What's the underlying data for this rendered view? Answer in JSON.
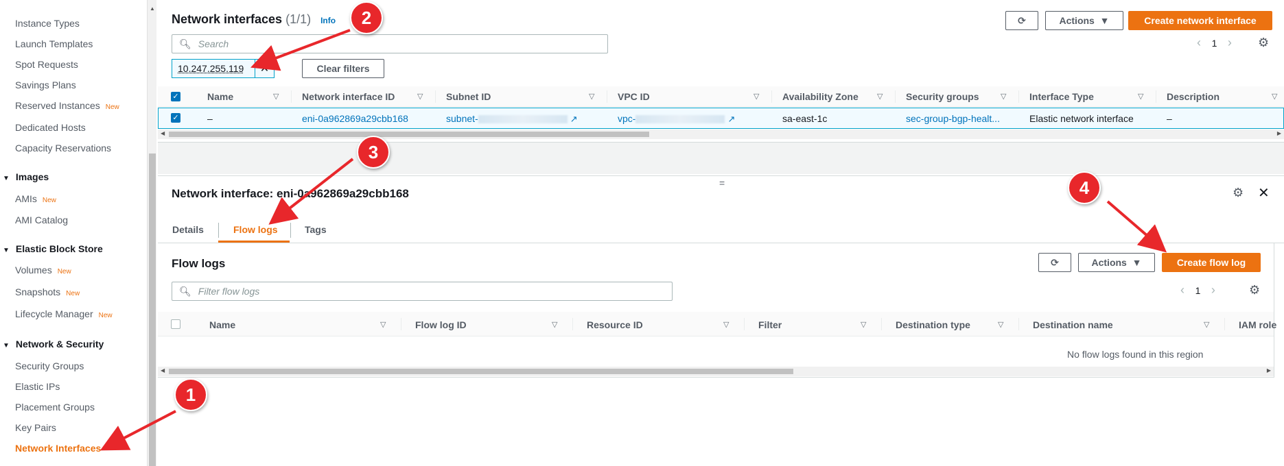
{
  "sidebar": {
    "items": [
      {
        "label": "Instance Types",
        "new": ""
      },
      {
        "label": "Launch Templates",
        "new": ""
      },
      {
        "label": "Spot Requests",
        "new": ""
      },
      {
        "label": "Savings Plans",
        "new": ""
      },
      {
        "label": "Reserved Instances",
        "new": "New"
      },
      {
        "label": "Dedicated Hosts",
        "new": ""
      },
      {
        "label": "Capacity Reservations",
        "new": ""
      }
    ],
    "images_section": "Images",
    "images_items": [
      {
        "label": "AMIs",
        "new": "New"
      },
      {
        "label": "AMI Catalog",
        "new": ""
      }
    ],
    "ebs_section": "Elastic Block Store",
    "ebs_items": [
      {
        "label": "Volumes",
        "new": "New"
      },
      {
        "label": "Snapshots",
        "new": "New"
      },
      {
        "label": "Lifecycle Manager",
        "new": "New"
      }
    ],
    "netsec_section": "Network & Security",
    "netsec_items": [
      {
        "label": "Security Groups"
      },
      {
        "label": "Elastic IPs"
      },
      {
        "label": "Placement Groups"
      },
      {
        "label": "Key Pairs"
      },
      {
        "label": "Network Interfaces"
      }
    ]
  },
  "ni_panel": {
    "title": "Network interfaces",
    "count": "(1/1)",
    "info": "Info",
    "actions_label": "Actions",
    "create_label": "Create network interface",
    "search_placeholder": "Search",
    "filter_token": "10.247.255.119",
    "clear_filters": "Clear filters",
    "page": "1",
    "columns": [
      "Name",
      "Network interface ID",
      "Subnet ID",
      "VPC ID",
      "Availability Zone",
      "Security groups",
      "Interface Type",
      "Description"
    ],
    "row": {
      "name": "–",
      "eni_id": "eni-0a962869a29cbb168",
      "subnet_prefix": "subnet-",
      "vpc_prefix": "vpc-",
      "az": "sa-east-1c",
      "security_groups": "sec-group-bgp-healt...",
      "interface_type": "Elastic network interface",
      "description": "–"
    }
  },
  "detail": {
    "title": "Network interface: eni-0a962869a29cbb168",
    "resize_handle": "=",
    "tabs": [
      "Details",
      "Flow logs",
      "Tags"
    ],
    "flow_logs_title": "Flow logs",
    "actions_label": "Actions",
    "create_flow_log": "Create flow log",
    "filter_placeholder": "Filter flow logs",
    "page": "1",
    "columns": [
      "Name",
      "Flow log ID",
      "Resource ID",
      "Filter",
      "Destination type",
      "Destination name",
      "IAM role"
    ],
    "empty_message": "No flow logs found in this region"
  },
  "annotations": [
    "1",
    "2",
    "3",
    "4"
  ],
  "colors": {
    "accent": "#ec7211",
    "link": "#0073bb",
    "annotation": "#e8272b"
  }
}
